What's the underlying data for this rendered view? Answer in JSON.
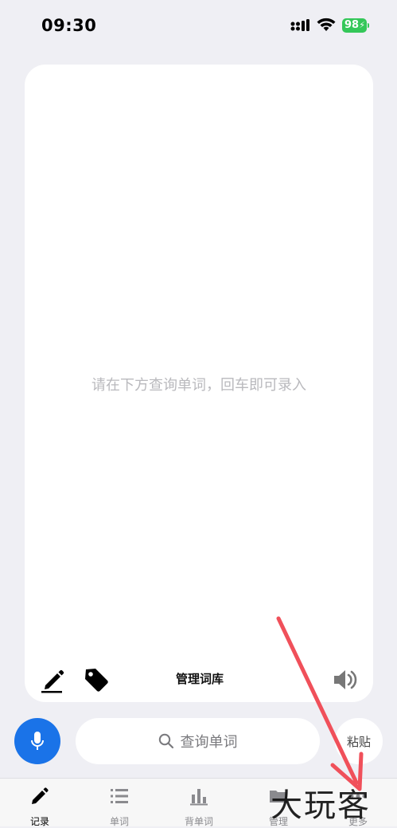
{
  "status_bar": {
    "time": "09:30",
    "battery": "98"
  },
  "card": {
    "placeholder": "请在下方查询单词，回车即可录入",
    "manage_library": "管理词库"
  },
  "input_row": {
    "search_placeholder": "查询单词",
    "paste_label": "粘贴"
  },
  "tabs": [
    {
      "label": "记录",
      "icon": "pencil-icon",
      "active": true
    },
    {
      "label": "单词",
      "icon": "list-icon",
      "active": false
    },
    {
      "label": "背单词",
      "icon": "bar-chart-icon",
      "active": false
    },
    {
      "label": "管理",
      "icon": "folder-icon",
      "active": false
    },
    {
      "label": "更多",
      "icon": "more-icon",
      "active": false
    }
  ],
  "watermark": "大玩客",
  "colors": {
    "accent": "#1a73e8",
    "battery": "#34c759",
    "arrow": "#f0505a"
  }
}
